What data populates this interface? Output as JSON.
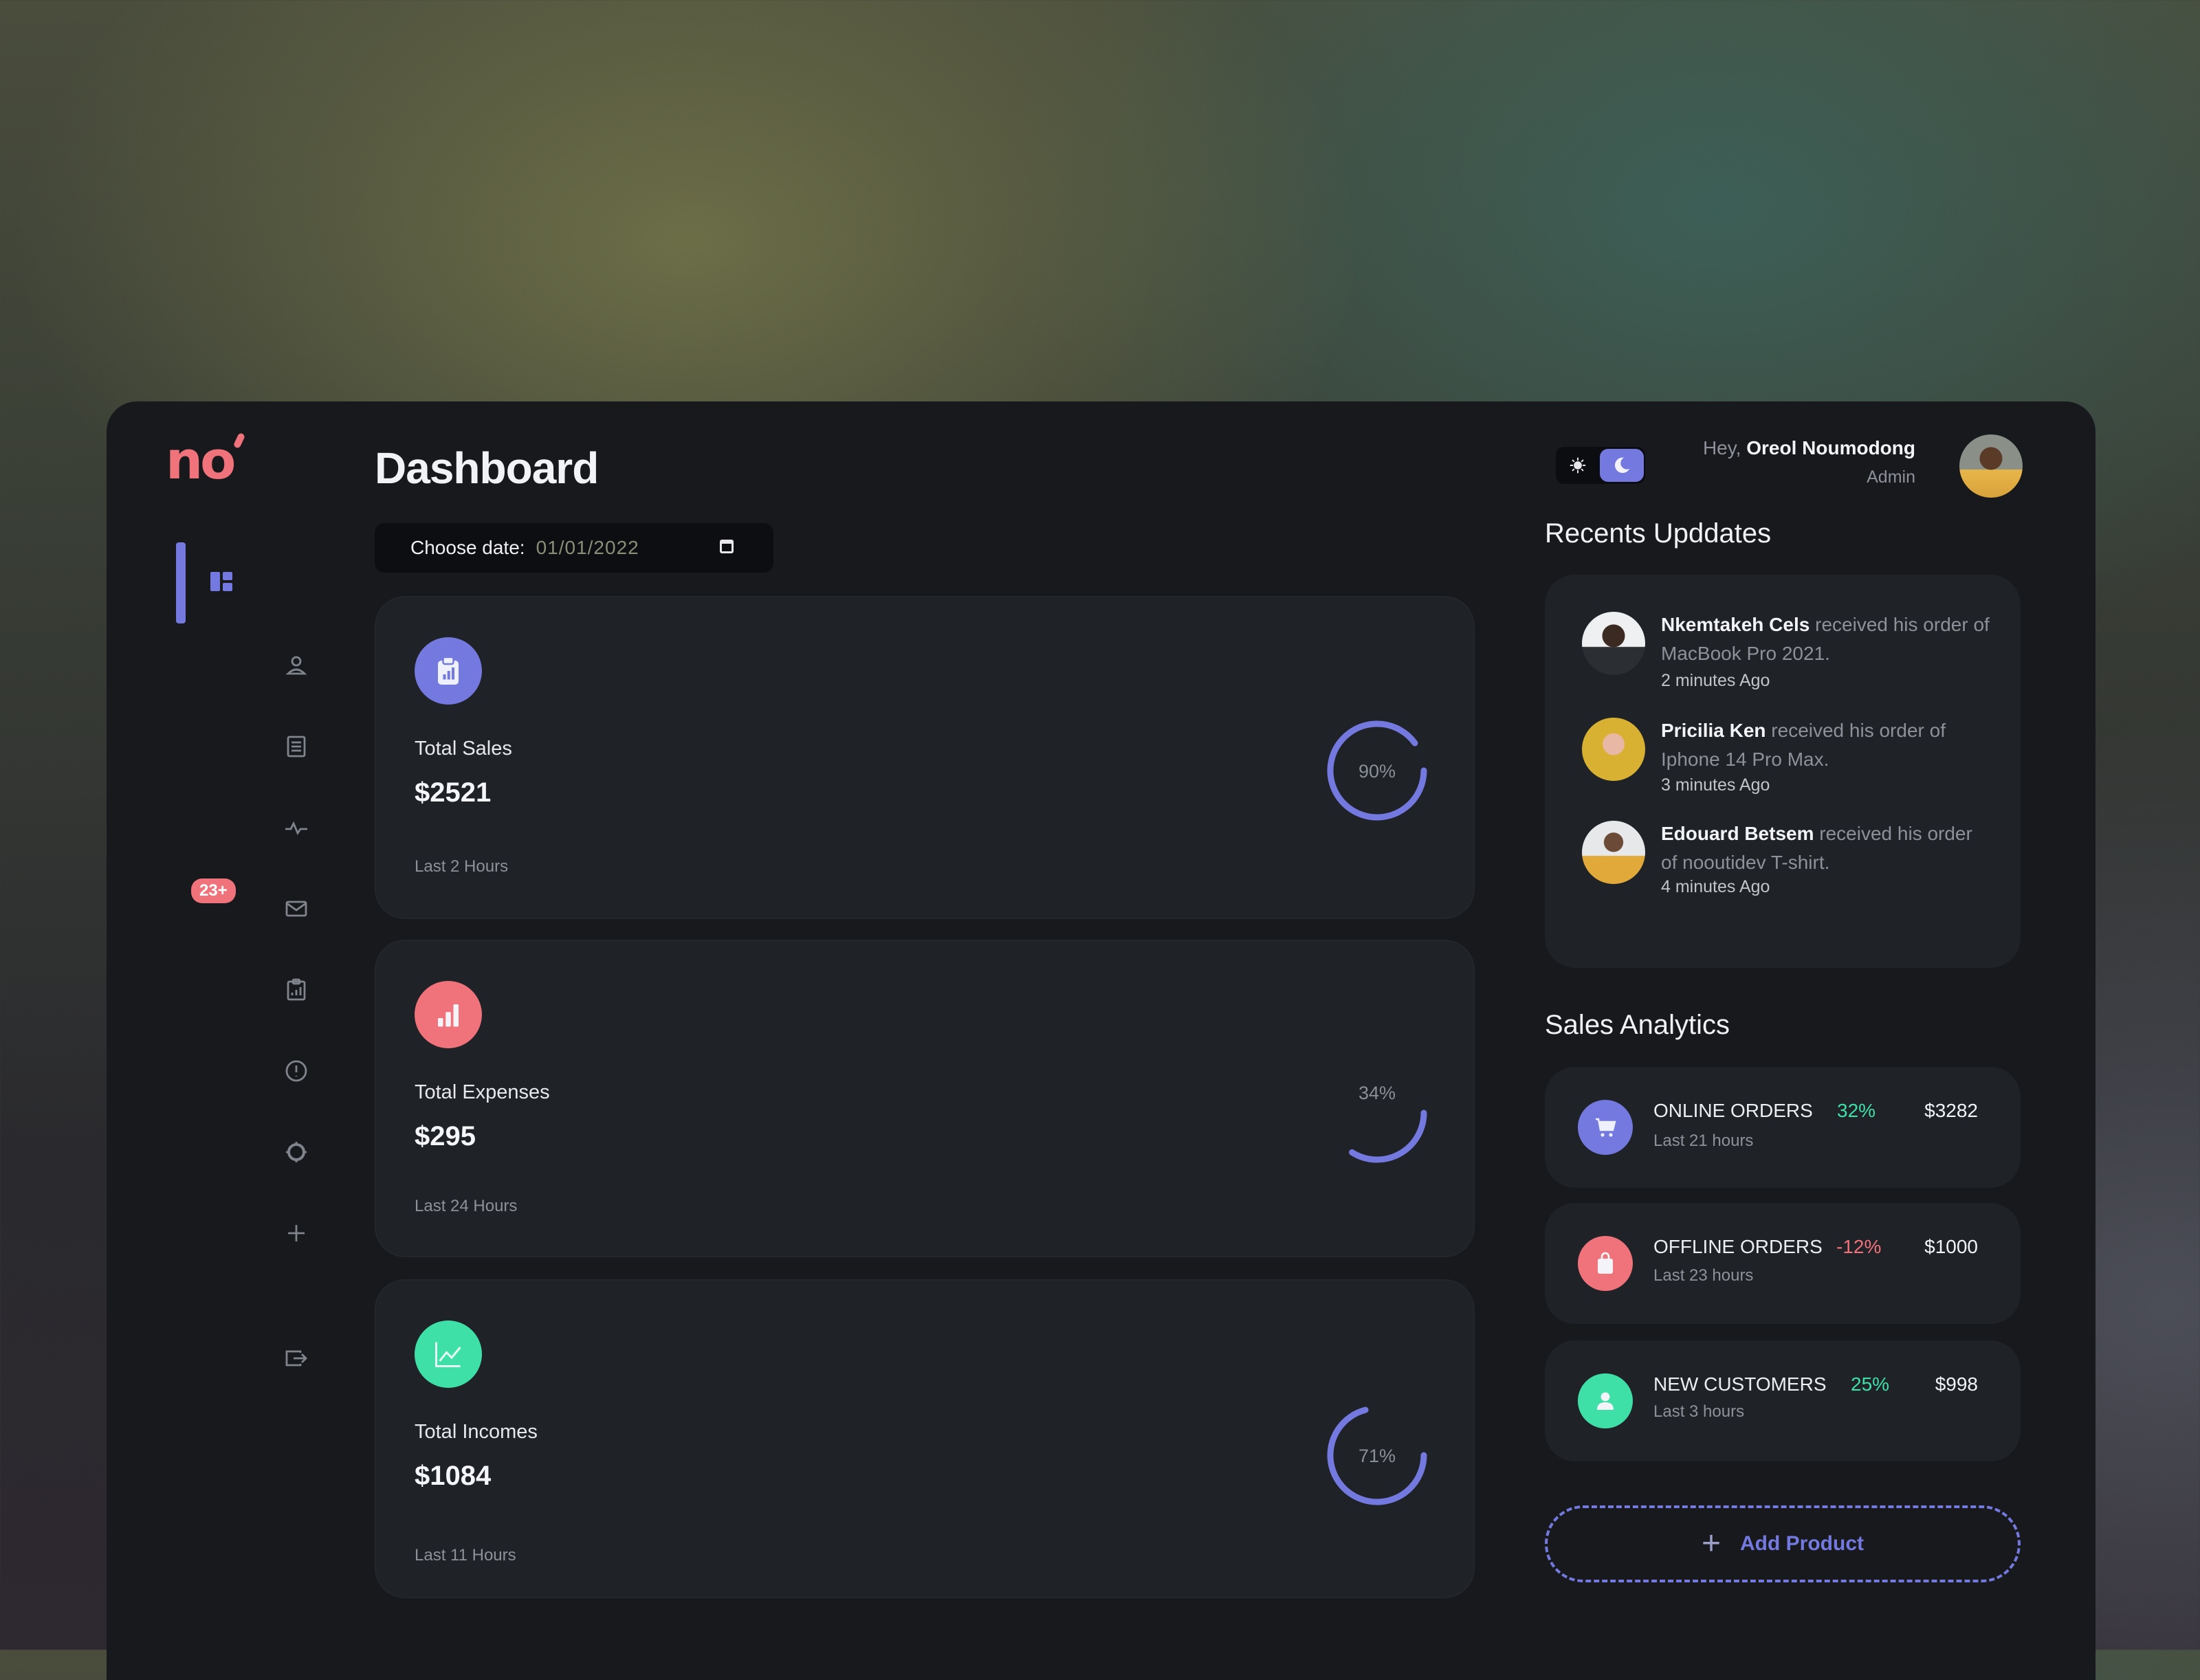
{
  "brand": {
    "logo_text": "no",
    "accent": "#7479e0",
    "coral": "#f0727a",
    "mint": "#3fe0a8"
  },
  "sidebar": {
    "items": [
      {
        "name": "dashboard",
        "icon": "dashboard-icon",
        "active": true
      },
      {
        "name": "customers",
        "icon": "user-icon"
      },
      {
        "name": "orders",
        "icon": "document-list-icon"
      },
      {
        "name": "activity",
        "icon": "pulse-icon"
      },
      {
        "name": "messages",
        "icon": "mail-icon",
        "badge": "23+"
      },
      {
        "name": "reports",
        "icon": "clipboard-chart-icon"
      },
      {
        "name": "alerts",
        "icon": "alert-circle-icon"
      },
      {
        "name": "settings",
        "icon": "gear-icon"
      },
      {
        "name": "add",
        "icon": "plus-icon"
      }
    ],
    "logout_icon": "logout-icon"
  },
  "header": {
    "title": "Dashboard",
    "date_label": "Choose date:",
    "date_value": "01/01/2022",
    "greeting_prefix": "Hey,",
    "user_name": "Oreol Noumodong",
    "user_role": "Admin",
    "theme": "dark"
  },
  "stats": [
    {
      "label": "Total Sales",
      "value": "$2521",
      "period": "Last 2 Hours",
      "progress_percent": 90,
      "progress_label": "90%",
      "icon": "clipboard-chart-icon",
      "color": "#7479e0"
    },
    {
      "label": "Total Expenses",
      "value": "$295",
      "period": "Last 24 Hours",
      "progress_percent": 34,
      "progress_label": "34%",
      "icon": "bar-chart-icon",
      "color": "#f0727a"
    },
    {
      "label": "Total Incomes",
      "value": "$1084",
      "period": "Last 11 Hours",
      "progress_percent": 71,
      "progress_label": "71%",
      "icon": "line-chart-icon",
      "color": "#3fe0a8"
    }
  ],
  "updates": {
    "title": "Recents Upddates",
    "items": [
      {
        "name": "Nkemtakeh Cels",
        "text": "received his order of MacBook Pro 2021.",
        "time": "2 minutes Ago"
      },
      {
        "name": "Pricilia Ken",
        "text": "received his order of Iphone 14 Pro Max.",
        "time": "3 minutes Ago"
      },
      {
        "name": "Edouard Betsem",
        "text": "received his order of nooutidev T-shirt.",
        "time": "4 minutes Ago"
      }
    ]
  },
  "analytics": {
    "title": "Sales Analytics",
    "items": [
      {
        "title": "ONLINE ORDERS",
        "period": "Last 21 hours",
        "change": "32%",
        "change_color": "#3fe0a8",
        "amount": "$3282",
        "icon": "cart-icon",
        "color": "#7479e0"
      },
      {
        "title": "OFFLINE ORDERS",
        "period": "Last 23 hours",
        "change": "-12%",
        "change_color": "#f0727a",
        "amount": "$1000",
        "icon": "shopping-bag-icon",
        "color": "#f0727a"
      },
      {
        "title": "NEW CUSTOMERS",
        "period": "Last 3 hours",
        "change": "25%",
        "change_color": "#3fe0a8",
        "amount": "$998",
        "icon": "user-icon",
        "color": "#3fe0a8"
      }
    ],
    "add_button_label": "Add Product"
  }
}
